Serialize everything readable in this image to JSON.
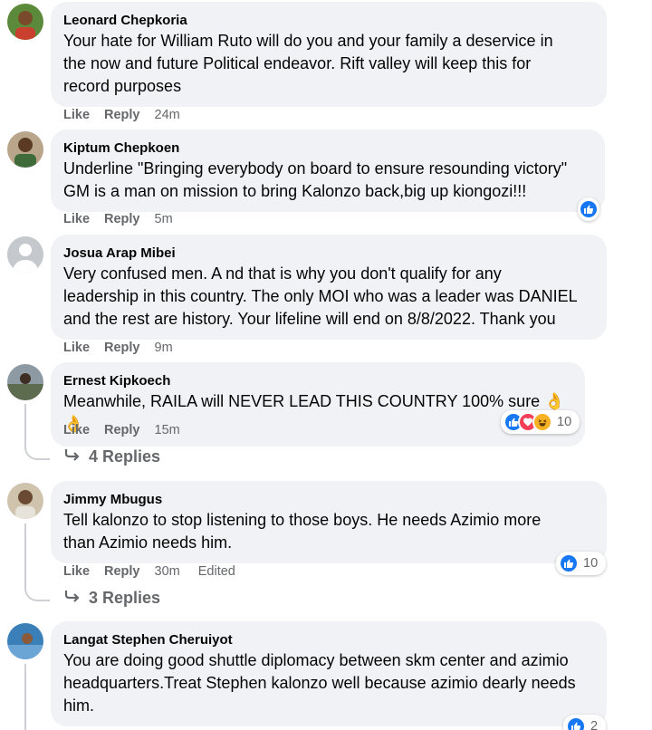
{
  "comments": [
    {
      "author": "Leonard Chepkoria",
      "text": "Your hate for William Ruto will do you and your family a deservice in\nthe now and future Political endeavor. Rift valley will keep this for\nrecord purposes",
      "like": "Like",
      "reply": "Reply",
      "time": "24m"
    },
    {
      "author": "Kiptum Chepkoen",
      "text": "Underline \"Bringing everybody on board to ensure resounding victory\"\nGM is a man on mission to bring Kalonzo back,big up kiongozi!!!",
      "like": "Like",
      "reply": "Reply",
      "time": "5m"
    },
    {
      "author": "Josua Arap Mibei",
      "text": "Very confused men. A nd that is why you don't qualify for any\nleadership in this country. The only MOI who was a leader was DANIEL\nand the rest are history. Your lifeline will end on 8/8/2022. Thank you",
      "like": "Like",
      "reply": "Reply",
      "time": "9m"
    },
    {
      "author": "Ernest Kipkoech",
      "text": "Meanwhile, RAILA will NEVER LEAD THIS COUNTRY 100% sure 👌👌",
      "like": "Like",
      "reply": "Reply",
      "time": "15m",
      "reaction_count": "10",
      "replies_label": "4 Replies"
    },
    {
      "author": "Jimmy Mbugus",
      "text": "Tell kalonzo to stop listening to those boys. He needs Azimio more\nthan Azimio needs him.",
      "like": "Like",
      "reply": "Reply",
      "time": "30m",
      "edited": "Edited",
      "reaction_count": "10",
      "replies_label": "3 Replies"
    },
    {
      "author": "Langat Stephen Cheruiyot",
      "text": "You are doing good shuttle diplomacy between skm center and azimio\nheadquarters.Treat Stephen kalonzo well because azimio dearly needs\nhim.",
      "reaction_count": "2"
    }
  ],
  "colors": {
    "like_blue": "#1877f2",
    "love_red": "#f33e58",
    "haha_yellow": "#f7b125",
    "bubble": "#f0f2f5",
    "meta_gray": "#65676b"
  },
  "icons": [
    "like-icon",
    "love-icon",
    "haha-icon",
    "reply-arrow-icon"
  ]
}
